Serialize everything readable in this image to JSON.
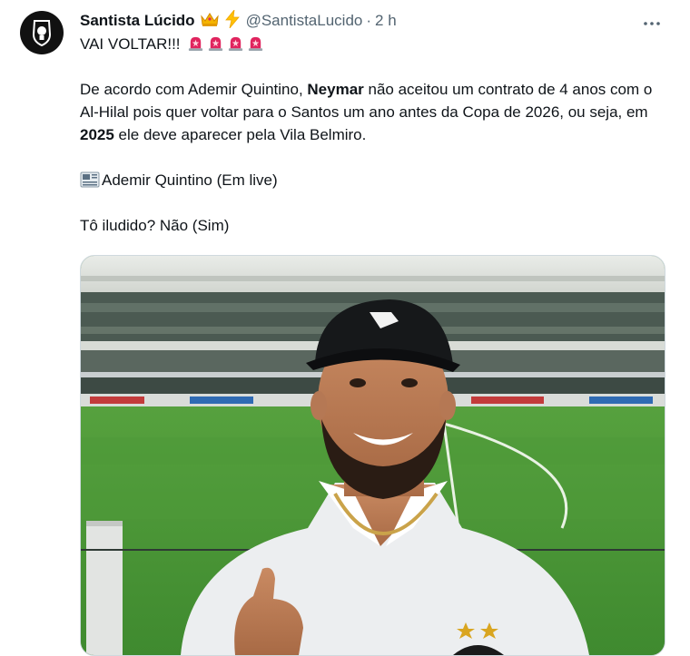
{
  "tweet": {
    "display_name": "Santista Lúcido",
    "handle": "@SantistaLucido",
    "separator": "·",
    "time": "2 h",
    "line1": "VAI VOLTAR!!!",
    "p2_a": "De acordo com Ademir Quintino, ",
    "p2_bold1": "Neymar",
    "p2_b": " não aceitou um contrato de 4 anos com o Al-Hilal pois quer voltar para o Santos um ano antes da Copa de 2026, ou seja, em ",
    "p2_bold2": "2025",
    "p2_c": " ele deve aparecer pela Vila Belmiro.",
    "source": "Ademir Quintino (Em live)",
    "question": "Tô iludido? Não (Sim)"
  },
  "icons": {
    "avatar": "lightbulb-shield-icon",
    "crown": "crown-icon",
    "lightning": "lightning-icon",
    "more": "more-dots-icon",
    "alarm": "police-light-icon",
    "newspaper": "newspaper-icon"
  },
  "colors": {
    "text": "#0f1419",
    "secondary": "#536471",
    "border": "#cfd9de",
    "avatar_bg": "#111111",
    "alarm_red": "#e0245e"
  }
}
